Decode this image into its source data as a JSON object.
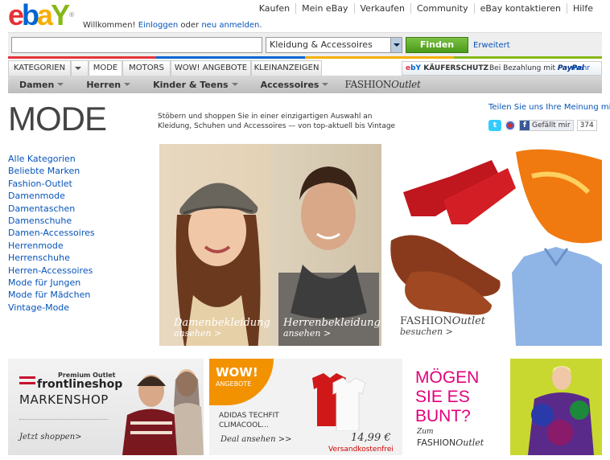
{
  "header": {
    "logo": {
      "e": "e",
      "b": "b",
      "a": "a",
      "y": "Y",
      "tm": "®"
    },
    "welcome_prefix": "Willkommen! ",
    "login_link": "Einloggen",
    "or": " oder ",
    "register_link": "neu anmelden",
    "suffix": ".",
    "topnav": [
      "Kaufen",
      "Mein eBay",
      "Verkaufen",
      "Community",
      "eBay kontaktieren",
      "Hilfe"
    ]
  },
  "search": {
    "value": "",
    "category": "Kleidung & Accessoires",
    "button": "Finden",
    "advanced": "Erweitert"
  },
  "tabs": {
    "kategorien": "KATEGORIEN",
    "mode": "MODE",
    "motors": "MOTORS",
    "wow": "WOW! ANGEBOTE",
    "kleinanzeigen": "KLEINANZEIGEN",
    "kaeuferschutz": "KÄUFERSCHUTZ",
    "kaeufer_e": "e",
    "kaeufer_b": "bY",
    "paypal_text": "Bei Bezahlung mit ",
    "paypal": "PayPal",
    "mehr": "mehr"
  },
  "subnav": {
    "items": [
      "Damen",
      "Herren",
      "Kinder & Teens",
      "Accessoires"
    ],
    "fashion": "FASHION",
    "outlet": "Outlet"
  },
  "page": {
    "title": "MODE",
    "intro": "Stöbern und shoppen Sie in einer einzigartigen Auswahl an Kleidung, Schuhen und Accessoires — von top-aktuell bis Vintage",
    "feedback": "Teilen Sie uns Ihre Meinung mit",
    "like": "Gefällt mir",
    "like_count": "374",
    "twitter": "t",
    "facebook": "f"
  },
  "sidenav": [
    "Alle Kategorien",
    "Beliebte Marken",
    "Fashion-Outlet",
    "Damenmode",
    "Damentaschen",
    "Damenschuhe",
    "Damen-Accessoires",
    "Herrenmode",
    "Herrenschuhe",
    "Herren-Accessoires",
    "Mode für Jungen",
    "Mode für Mädchen",
    "Vintage-Mode"
  ],
  "hero": {
    "women": "Damenbekleidung",
    "women_cta": "ansehen >",
    "men": "Herrenbekleidung",
    "men_cta": "ansehen >",
    "outlet_a": "FASHION",
    "outlet_b": "Outlet",
    "outlet_cta": "besuchen >"
  },
  "banners": {
    "premium": "Premium Outlet",
    "frontline": "frontlineshop",
    "markenshop": "MARKENSHOP",
    "jetzt": "Jetzt shoppen>",
    "wow": "WOW!",
    "angebote": "ANGEBOTE",
    "product": "ADIDAS TECHFIT",
    "product2": "CLIMACOOL...",
    "deal": "Deal ansehen >>",
    "price": "14,99 €",
    "shipping": "Versandkostenfrei",
    "bunt1": "MÖGEN",
    "bunt2": "SIE ES",
    "bunt3": "BUNT?",
    "zum": "Zum",
    "fo_a": "FASHION",
    "fo_b": "Outlet"
  },
  "colors": {
    "ebay_red": "#e53238",
    "ebay_blue": "#0064d2",
    "ebay_yellow": "#f5af02",
    "ebay_green": "#86b817",
    "link": "#0654ba",
    "wow_orange": "#f39200",
    "bunt_pink": "#e4007c"
  }
}
